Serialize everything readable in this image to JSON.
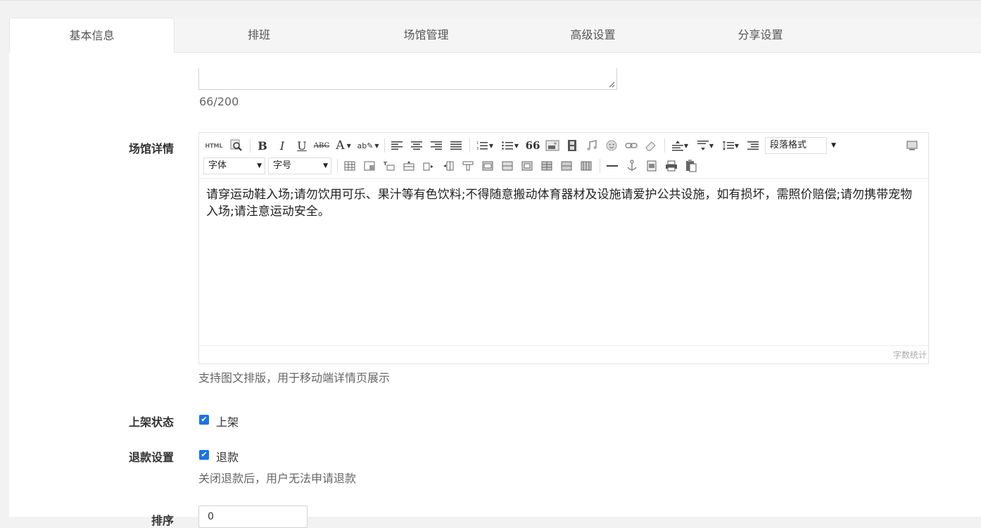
{
  "tabs": [
    {
      "label": "基本信息",
      "active": true
    },
    {
      "label": "排班",
      "active": false
    },
    {
      "label": "场馆管理",
      "active": false
    },
    {
      "label": "高级设置",
      "active": false
    },
    {
      "label": "分享设置",
      "active": false
    }
  ],
  "intro": {
    "counter": "66/200"
  },
  "detail": {
    "label": "场馆详情",
    "toolbar": {
      "html_btn": "HTML",
      "bold": "B",
      "italic": "I",
      "underline": "U",
      "strike": "ABC",
      "font_color": "A",
      "quote": "66",
      "paragraph_select": "段落格式",
      "font_select": "字体",
      "size_select": "字号"
    },
    "content": "请穿运动鞋入场;请勿饮用可乐、果汁等有色饮料;不得随意搬动体育器材及设施请爱护公共设施，如有损坏，需照价赔偿;请勿携带宠物入场;请注意运动安全。",
    "word_count": "字数统计",
    "help": "支持图文排版，用于移动端详情页展示"
  },
  "listing": {
    "label": "上架状态",
    "option": "上架",
    "checked": true
  },
  "refund": {
    "label": "退款设置",
    "option": "退款",
    "checked": true,
    "help": "关闭退款后，用户无法申请退款"
  },
  "sort": {
    "label": "排序",
    "value": "0"
  },
  "colors": {
    "accent": "#1a73e8",
    "tab_bg": "#f5f5f5",
    "page_bg": "#f2f2f2"
  }
}
